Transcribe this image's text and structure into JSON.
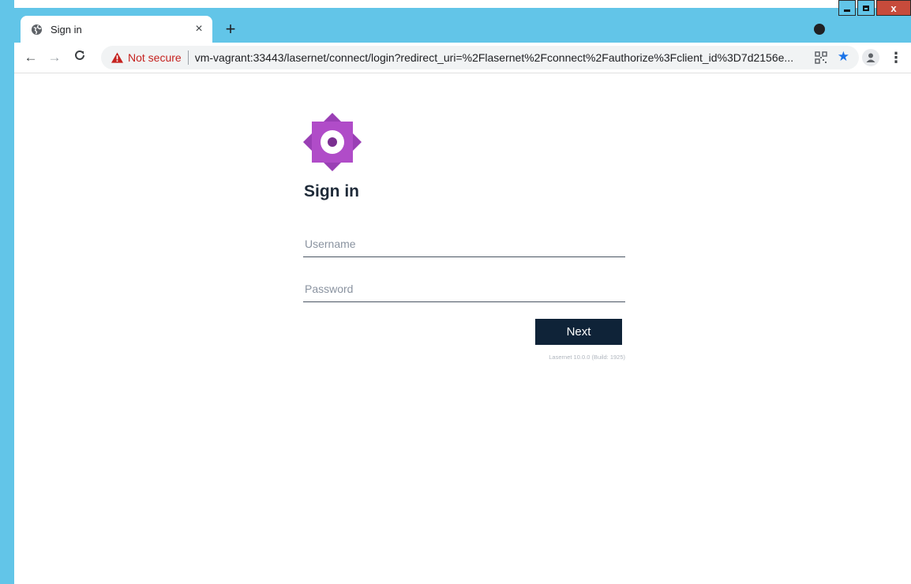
{
  "browser": {
    "tab": {
      "title": "Sign in",
      "favicon": "globe-icon",
      "close_label": "×"
    },
    "new_tab_label": "+",
    "window_controls": {
      "close_label": "x"
    },
    "toolbar": {
      "back_label": "←",
      "forward_label": "→",
      "reload_label": "C",
      "security_label": "Not secure",
      "url": "vm-vagrant:33443/lasernet/connect/login?redirect_uri=%2Flasernet%2Fconnect%2Fauthorize%3Fclient_id%3D7d2156e...",
      "menu_label": "⋮"
    }
  },
  "login": {
    "title": "Sign in",
    "username_placeholder": "Username",
    "password_placeholder": "Password",
    "next_label": "Next",
    "version": "Lasernet 10.0.0 (Build: 1925)"
  },
  "colors": {
    "accent": "#62c5e8",
    "logo": "#b04cc8",
    "button": "#0f2338"
  }
}
